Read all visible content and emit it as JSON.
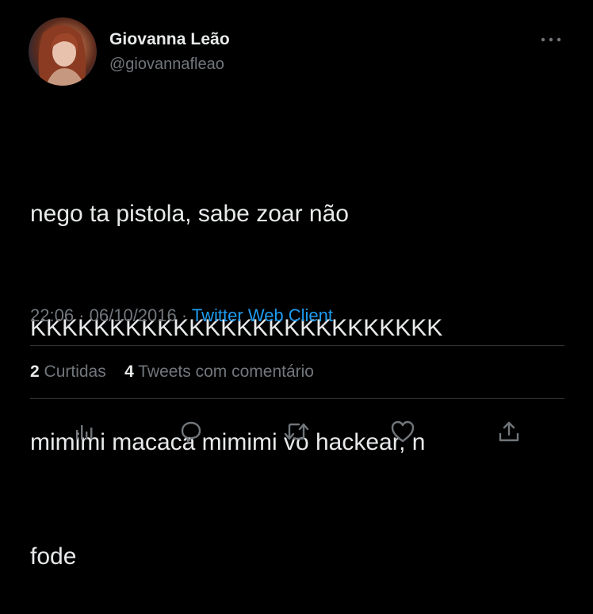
{
  "author": {
    "name": "Giovanna Leão",
    "handle": "@giovannafleao"
  },
  "tweet": {
    "lines": [
      "nego ta pistola, sabe zoar não",
      "KKKKKKKKKKKKKKKKKKKKKKKKKK",
      "mimimi macaca mimimi vo hackear, n",
      "fode"
    ]
  },
  "meta": {
    "time": "22:06",
    "separator": "·",
    "date": "06/10/2016",
    "client": "Twitter Web Client"
  },
  "stats": {
    "likes_count": "2",
    "likes_label": "Curtidas",
    "quotes_count": "4",
    "quotes_label": "Tweets com comentário"
  },
  "icons": {
    "more": "more-icon",
    "analytics": "analytics-icon",
    "reply": "reply-icon",
    "retweet": "retweet-icon",
    "like": "heart-icon",
    "share": "share-icon"
  },
  "colors": {
    "background": "#000000",
    "text": "#e7e9ea",
    "secondary": "#71767b",
    "link": "#1d9bf0",
    "divider": "#2f3336"
  }
}
